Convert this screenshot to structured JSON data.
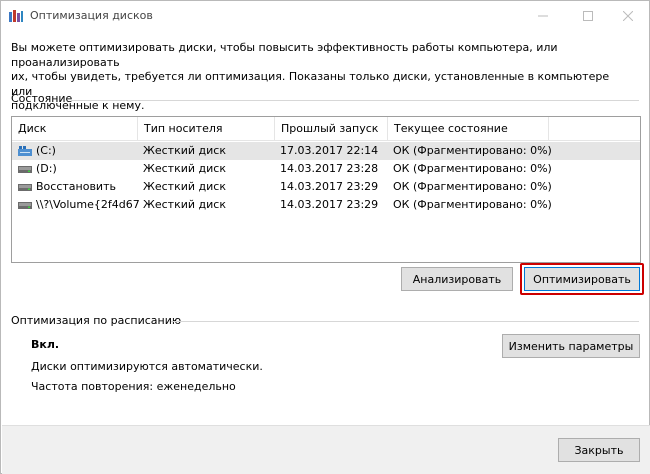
{
  "window": {
    "title": "Оптимизация дисков"
  },
  "description": {
    "line1": "Вы можете оптимизировать диски, чтобы повысить эффективность работы  компьютера, или проанализировать",
    "line2": "их, чтобы увидеть, требуется ли оптимизация. Показаны только диски, установленные в компьютере или",
    "line3": "подключенные к нему."
  },
  "status": {
    "label": "Состояние",
    "columns": [
      "Диск",
      "Тип носителя",
      "Прошлый запуск",
      "Текущее состояние"
    ],
    "drives": [
      {
        "name": "(C:)",
        "media": "Жесткий диск",
        "last_run": "17.03.2017 22:14",
        "state": "ОК (Фрагментировано: 0%)",
        "icon": "system-drive-icon"
      },
      {
        "name": "(D:)",
        "media": "Жесткий диск",
        "last_run": "14.03.2017 23:28",
        "state": "ОК (Фрагментировано: 0%)",
        "icon": "hard-drive-icon"
      },
      {
        "name": "Восстановить",
        "media": "Жесткий диск",
        "last_run": "14.03.2017 23:29",
        "state": "ОК (Фрагментировано: 0%)",
        "icon": "hard-drive-icon"
      },
      {
        "name": "\\\\?\\Volume{2f4d67...",
        "media": "Жесткий диск",
        "last_run": "14.03.2017 23:29",
        "state": "ОК (Фрагментировано: 0%)",
        "icon": "hard-drive-icon"
      }
    ]
  },
  "buttons": {
    "analyze": "Анализировать",
    "optimize": "Оптимизировать",
    "change_settings": "Изменить параметры",
    "close": "Закрыть"
  },
  "schedule": {
    "label": "Оптимизация по расписанию",
    "state": "Вкл.",
    "auto_text": "Диски оптимизируются автоматически.",
    "frequency": "Частота повторения: еженедельно"
  },
  "colors": {
    "highlight": "#cc0000",
    "selected_row": "#e5e5e5",
    "button_bg": "#e1e1e1",
    "accent": "#0078d7"
  }
}
